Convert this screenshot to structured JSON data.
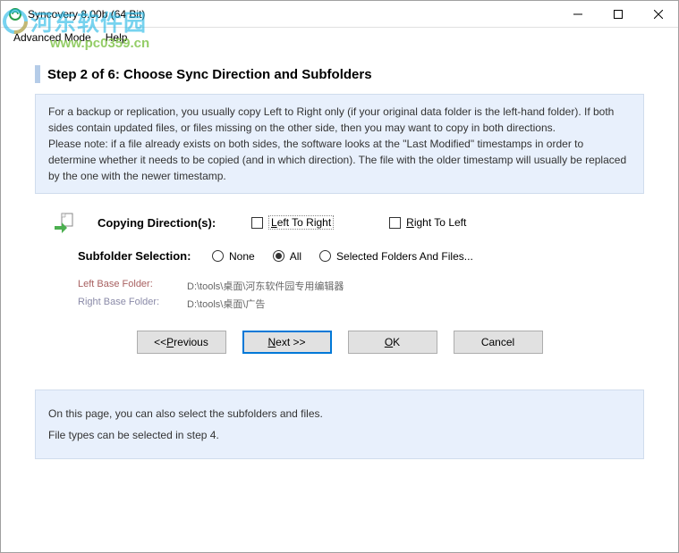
{
  "window": {
    "title": "Syncovery 8.00b (64 Bit)"
  },
  "menu": {
    "advanced": "Advanced Mode",
    "help": "Help"
  },
  "step": {
    "title": "Step 2 of 6: Choose Sync Direction and Subfolders"
  },
  "info": {
    "p1": "For a backup or replication, you usually copy Left to Right only (if your original data folder is the left-hand folder). If both sides contain updated files, or files missing on the other side, then you may want to copy in both directions.",
    "p2": "Please note: if a file already exists on both sides, the software looks at the  \"Last Modified\"  timestamps in order to determine whether it needs to be copied (and in which direction). The file with the older timestamp will usually be replaced by the one with the newer timestamp."
  },
  "direction": {
    "label": "Copying Direction(s):",
    "ltr": "Left To Right",
    "rtl": "Right To Left"
  },
  "subfolder": {
    "label": "Subfolder Selection:",
    "none": "None",
    "all": "All",
    "selected": "Selected Folders And Files..."
  },
  "paths": {
    "left_label": "Left Base Folder:",
    "left_value": "D:\\tools\\桌面\\河东软件园专用编辑器",
    "right_label": "Right Base Folder:",
    "right_value": "D:\\tools\\桌面\\广告"
  },
  "buttons": {
    "previous": "<< Previous",
    "next": "Next >>",
    "ok": "OK",
    "cancel": "Cancel"
  },
  "footer": {
    "line1": "On this page, you can also select the subfolders and files.",
    "line2": "File types can be selected in step 4."
  },
  "watermark": {
    "cn": "河东软件园",
    "url": "www.pc0359.cn"
  }
}
